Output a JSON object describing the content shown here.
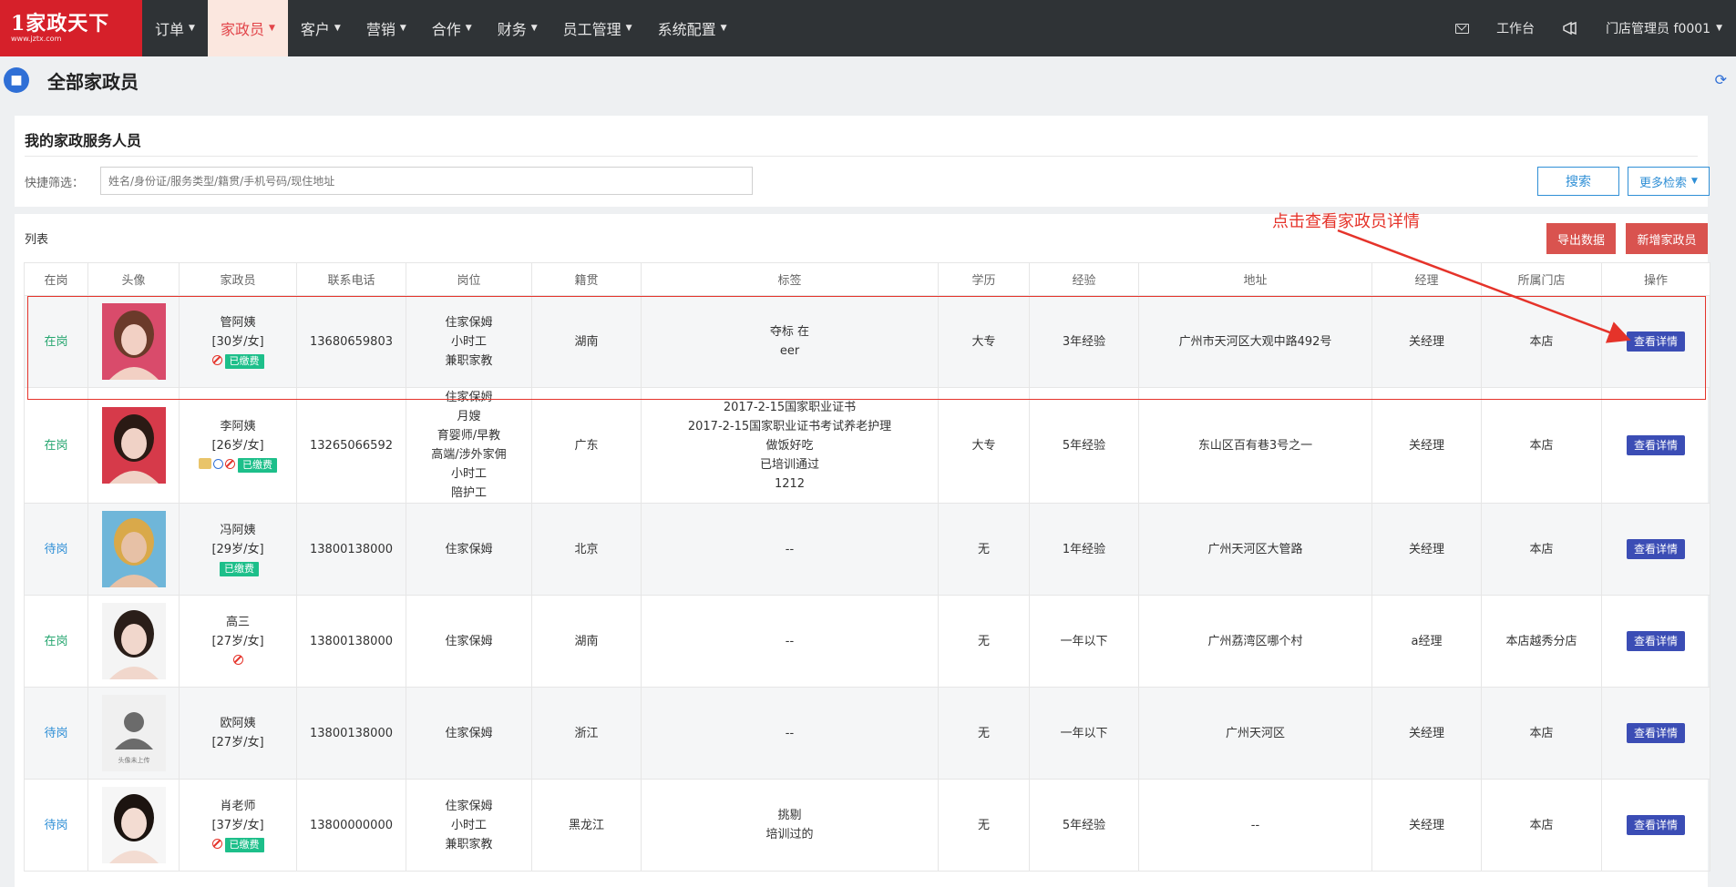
{
  "logo": {
    "brand": "1家政天下",
    "sub": "www.jztx.com"
  },
  "nav": [
    {
      "label": "订单"
    },
    {
      "label": "家政员"
    },
    {
      "label": "客户"
    },
    {
      "label": "营销"
    },
    {
      "label": "合作"
    },
    {
      "label": "财务"
    },
    {
      "label": "员工管理"
    },
    {
      "label": "系统配置"
    }
  ],
  "topright": {
    "workbench": "工作台",
    "user": "门店管理员 f0001"
  },
  "page": {
    "title": "全部家政员"
  },
  "filter": {
    "title": "我的家政服务人员",
    "label": "快捷筛选：",
    "placeholder": "姓名/身份证/服务类型/籍贯/手机号码/现住地址",
    "search": "搜索",
    "more": "更多检索"
  },
  "list": {
    "label": "列表",
    "export": "导出数据",
    "add": "新增家政员",
    "annotation": "点击查看家政员详情",
    "columns": [
      "在岗",
      "头像",
      "家政员",
      "联系电话",
      "岗位",
      "籍贯",
      "标签",
      "学历",
      "经验",
      "地址",
      "经理",
      "所属门店",
      "操作"
    ],
    "detail_label": "查看详情",
    "rows": [
      {
        "status": "在岗",
        "name": "管阿姨",
        "meta": "[30岁/女]",
        "paid": "已缴费",
        "phone": "13680659803",
        "posts": [
          "住家保姆",
          "小时工",
          "兼职家教"
        ],
        "origin": "湖南",
        "tags": [
          "夺标 在",
          "eer"
        ],
        "edu": "大专",
        "exp": "3年经验",
        "addr": "广州市天河区大观中路492号",
        "mgr": "关经理",
        "store": "本店"
      },
      {
        "status": "在岗",
        "name": "李阿姨",
        "meta": "[26岁/女]",
        "paid": "已缴费",
        "phone": "13265066592",
        "posts": [
          "住家保姆",
          "月嫂",
          "育婴师/早教",
          "高端/涉外家佣",
          "小时工",
          "陪护工"
        ],
        "origin": "广东",
        "tags": [
          "2017-2-15国家职业证书",
          "2017-2-15国家职业证书考试养老护理",
          "做饭好吃",
          "已培训通过",
          "1212"
        ],
        "edu": "大专",
        "exp": "5年经验",
        "addr": "东山区百有巷3号之一",
        "mgr": "关经理",
        "store": "本店"
      },
      {
        "status": "待岗",
        "name": "冯阿姨",
        "meta": "[29岁/女]",
        "paid": "已缴费",
        "phone": "13800138000",
        "posts": [
          "住家保姆"
        ],
        "origin": "北京",
        "tags": [
          "--"
        ],
        "edu": "无",
        "exp": "1年经验",
        "addr": "广州天河区大管路",
        "mgr": "关经理",
        "store": "本店"
      },
      {
        "status": "在岗",
        "name": "高三",
        "meta": "[27岁/女]",
        "paid": "",
        "phone": "13800138000",
        "posts": [
          "住家保姆"
        ],
        "origin": "湖南",
        "tags": [
          "--"
        ],
        "edu": "无",
        "exp": "一年以下",
        "addr": "广州荔湾区哪个村",
        "mgr": "a经理",
        "store": "本店越秀分店"
      },
      {
        "status": "待岗",
        "name": "欧阿姨",
        "meta": "[27岁/女]",
        "paid": "",
        "phone": "13800138000",
        "posts": [
          "住家保姆"
        ],
        "origin": "浙江",
        "tags": [
          "--"
        ],
        "edu": "无",
        "exp": "一年以下",
        "addr": "广州天河区",
        "mgr": "关经理",
        "store": "本店",
        "avatar_text": "头像未上传"
      },
      {
        "status": "待岗",
        "name": "肖老师",
        "meta": "[37岁/女]",
        "paid": "已缴费",
        "phone": "13800000000",
        "posts": [
          "住家保姆",
          "小时工",
          "兼职家教"
        ],
        "origin": "黑龙江",
        "tags": [
          "挑剔",
          "培训过的"
        ],
        "edu": "无",
        "exp": "5年经验",
        "addr": "--",
        "mgr": "关经理",
        "store": "本店"
      }
    ]
  },
  "colors": {
    "accent": "#d6202a",
    "nav_bg": "#2f3336",
    "paid_badge": "#1dbf8a",
    "detail_btn": "#3b4db5",
    "annotation": "#e5332a"
  }
}
